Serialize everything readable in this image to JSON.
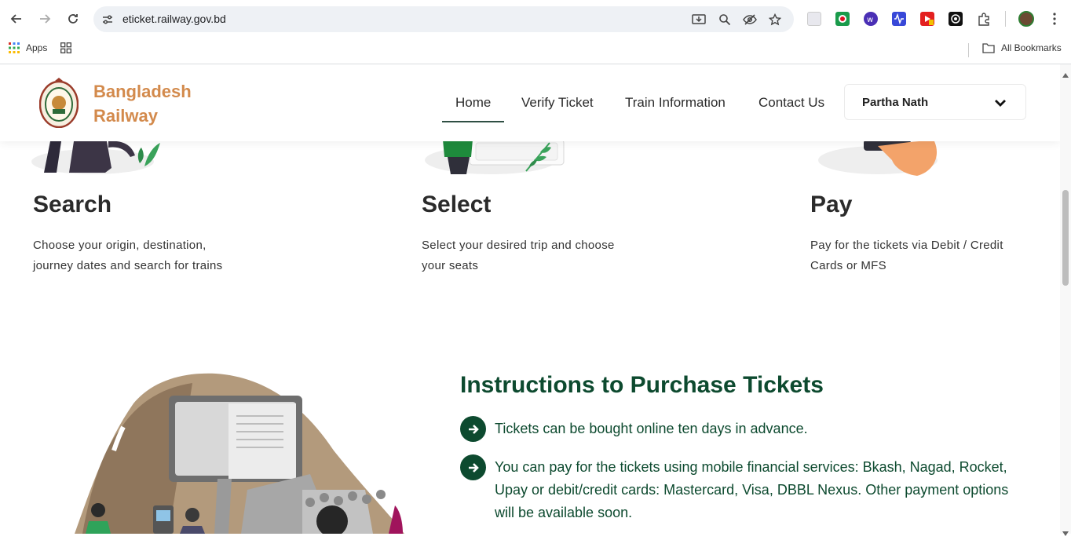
{
  "browser": {
    "url": "eticket.railway.gov.bd",
    "bookmarks": {
      "apps_label": "Apps",
      "all_bookmarks_label": "All Bookmarks"
    }
  },
  "site": {
    "brand_line1": "Bangladesh",
    "brand_line2": "Railway",
    "menu": {
      "home": "Home",
      "verify": "Verify Ticket",
      "train_info": "Train Information",
      "contact": "Contact Us"
    },
    "user_name": "Partha Nath"
  },
  "steps": [
    {
      "title": "Search",
      "desc_line1": "Choose your origin, destination,",
      "desc_line2": "journey dates and search for trains"
    },
    {
      "title": "Select",
      "desc_line1": "Select your desired trip and choose",
      "desc_line2": "your seats"
    },
    {
      "title": "Pay",
      "desc_line1": "Pay for the tickets via Debit / Credit",
      "desc_line2": "Cards or MFS"
    }
  ],
  "instructions": {
    "title": "Instructions to Purchase Tickets",
    "items": [
      "Tickets can be bought online ten days in advance.",
      "You can pay for the tickets using mobile financial services: Bkash, Nagad, Rocket, Upay or debit/credit cards: Mastercard, Visa, DBBL Nexus. Other payment options will be available soon."
    ]
  },
  "colors": {
    "brand": "#d38a4c",
    "instruction_green": "#0d4a2f",
    "active_underline": "#2f4f43"
  }
}
